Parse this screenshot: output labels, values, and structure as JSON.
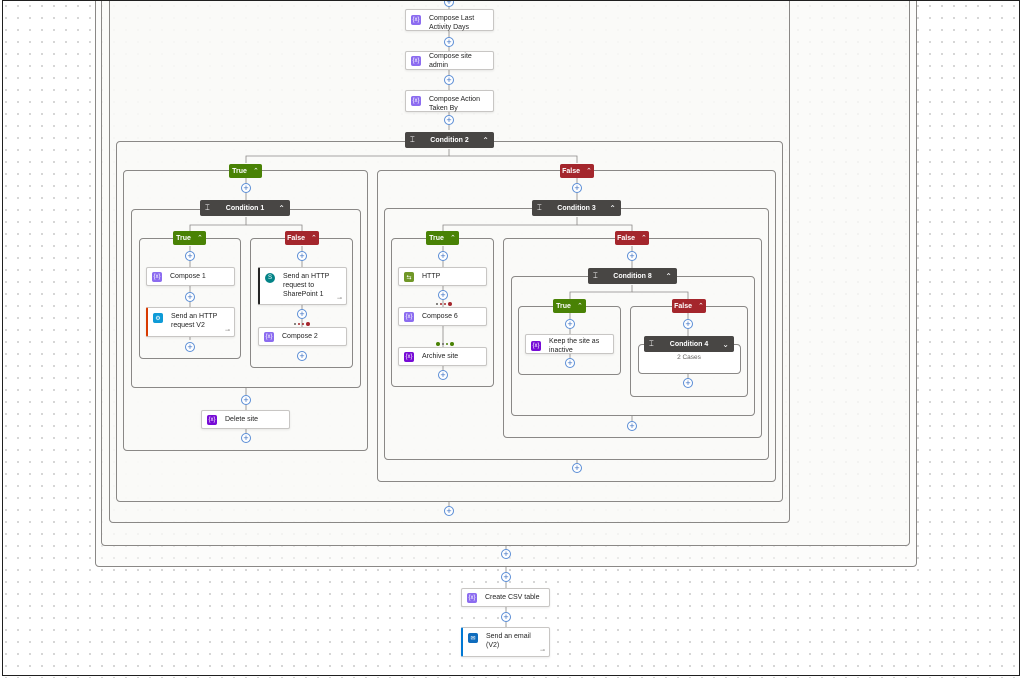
{
  "workflow": {
    "top_actions": {
      "compose_last_activity": "Compose Last Activity Days",
      "compose_site_admin": "Compose site admin",
      "compose_action_taken_by": "Compose Action Taken By"
    },
    "condition2": {
      "title": "Condition 2",
      "true_label": "True",
      "false_label": "False",
      "true_branch": {
        "condition1": {
          "title": "Condition 1",
          "true_label": "True",
          "false_label": "False",
          "true_actions": [
            "Compose 1",
            "Send an HTTP request V2"
          ],
          "false_actions": [
            "Send an HTTP request to SharePoint 1",
            "Compose 2"
          ]
        },
        "delete_site": "Delete site"
      },
      "false_branch": {
        "condition3": {
          "title": "Condition 3",
          "true_label": "True",
          "false_label": "False",
          "true_actions": [
            "HTTP",
            "Compose 6",
            "Archive site"
          ],
          "false_branch": {
            "condition8": {
              "title": "Condition 8",
              "true_label": "True",
              "false_label": "False",
              "true_actions": [
                "Keep the site as inactive"
              ],
              "false_branch": {
                "condition4": {
                  "title": "Condition 4",
                  "cases": "2 Cases"
                }
              }
            }
          }
        }
      }
    },
    "bottom_actions": {
      "create_csv_table": "Create CSV table",
      "send_email": "Send an email (V2)"
    }
  },
  "icons": {
    "compose": "compose-icon",
    "http": "http-icon",
    "sharepoint": "sharepoint-icon",
    "variable": "variable-icon",
    "outlook": "outlook-icon",
    "condition": "condition-icon",
    "add": "add-step-icon",
    "link": "link-icon"
  },
  "colors": {
    "true": "#498205",
    "false": "#a4262c",
    "condition_header": "#484644",
    "compose": "#8c6cf0",
    "variable": "#770bd6",
    "http": "#709727",
    "add": "#3a6fc2"
  }
}
